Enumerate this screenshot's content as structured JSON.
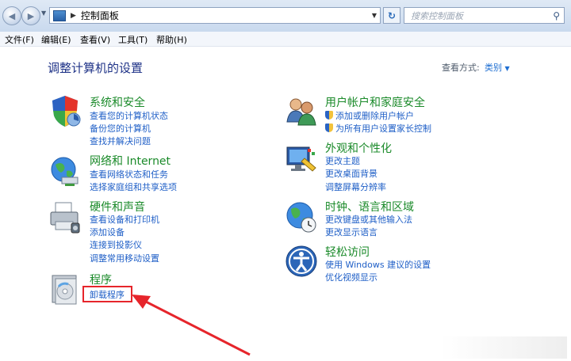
{
  "address": {
    "crumb": "控制面板"
  },
  "search": {
    "placeholder": "搜索控制面板"
  },
  "menu": [
    "文件(F)",
    "编辑(E)",
    "查看(V)",
    "工具(T)",
    "帮助(H)"
  ],
  "heading": "调整计算机的设置",
  "view_by": {
    "label": "查看方式:",
    "value": "类别"
  },
  "categories": [
    {
      "title": "系统和安全",
      "links": [
        "查看您的计算机状态",
        "备份您的计算机",
        "查找并解决问题"
      ]
    },
    {
      "title": "网络和 Internet",
      "links": [
        "查看网络状态和任务",
        "选择家庭组和共享选项"
      ]
    },
    {
      "title": "硬件和声音",
      "links": [
        "查看设备和打印机",
        "添加设备",
        "连接到投影仪",
        "调整常用移动设置"
      ]
    },
    {
      "title": "程序",
      "links": [
        "卸载程序"
      ]
    },
    {
      "title": "用户帐户和家庭安全",
      "links": [
        "添加或删除用户帐户",
        "为所有用户设置家长控制"
      ]
    },
    {
      "title": "外观和个性化",
      "links": [
        "更改主题",
        "更改桌面背景",
        "调整屏幕分辨率"
      ]
    },
    {
      "title": "时钟、语言和区域",
      "links": [
        "更改键盘或其他输入法",
        "更改显示语言"
      ]
    },
    {
      "title": "轻松访问",
      "links": [
        "使用 Windows 建议的设置",
        "优化视频显示"
      ]
    }
  ],
  "colors": {
    "category_title": "#1a8a29",
    "link": "#1f5fc7",
    "highlight": "#e6252b"
  },
  "icons": [
    "back-icon",
    "forward-icon",
    "control-panel-icon",
    "refresh-icon",
    "search-icon",
    "shield-icon",
    "network-icon",
    "printer-icon",
    "programs-icon",
    "users-icon",
    "monitor-palette-icon",
    "globe-clock-icon",
    "accessibility-icon"
  ]
}
